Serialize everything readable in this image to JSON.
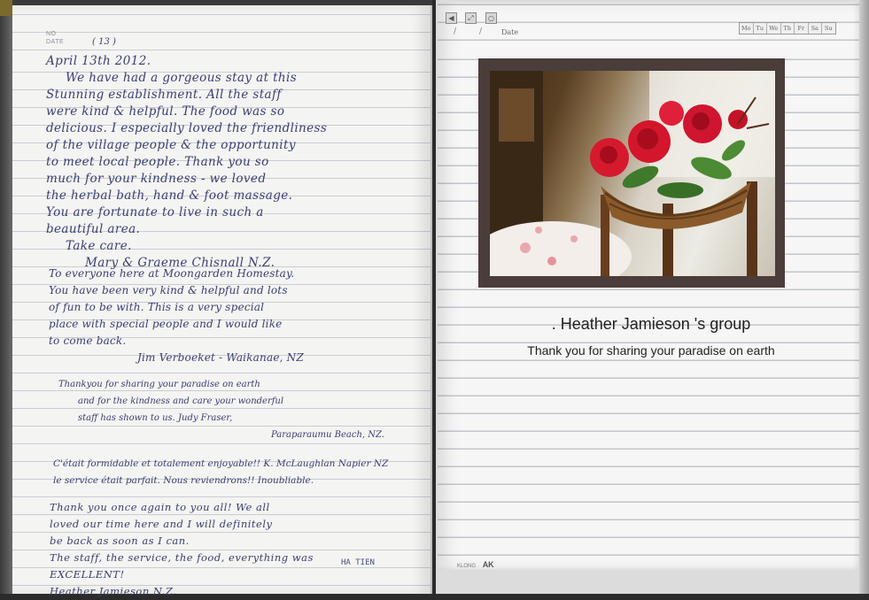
{
  "left_page": {
    "meta_no": "NO",
    "meta_date_label": "DATE",
    "meta_date_number": "( 13 )",
    "entry1": [
      "April 13th 2012.",
      "We have had a gorgeous stay at this",
      "Stunning establishment. All the staff",
      "were kind & helpful. The food was so",
      "delicious. I especially loved the friendliness",
      "of the village people & the opportunity",
      "to meet local people. Thank you so",
      "much for your kindness - we loved",
      "the herbal bath, hand & foot massage.",
      "You are fortunate to live in such a",
      "beautiful area.",
      "Take care.",
      "Mary & Graeme Chisnall N.Z."
    ],
    "entry2": [
      "To everyone here at Moongarden Homestay.",
      "You have been very kind & helpful and lots",
      "of fun to be with. This is a very special",
      "place with special people and I would like",
      "to come back.",
      "Jim Verboeket - Waikanae, NZ"
    ],
    "entry3": [
      "Thankyou for sharing your paradise on earth",
      "and for the kindness and care your wonderful",
      "staff has shown to us.   Judy Fraser,",
      "Paraparaumu Beach, NZ."
    ],
    "entry4": [
      "C'était formidable et totalement enjoyable!! K. McLaughlan Napier NZ",
      "le service était parfait. Nous reviendrons!! Inoubliable."
    ],
    "entry5": [
      "Thank you once again to you all! We all",
      "loved our time here and I will definitely",
      "be back as soon as I can.",
      "The staff, the service, the food, everything was",
      "EXCELLENT!",
      "Heather Jamieson N.Z."
    ],
    "stamp": "HA TIEN"
  },
  "right_page": {
    "date_label": "Date",
    "date_slash": "/",
    "weekdays": [
      "Mo",
      "Tu",
      "We",
      "Th",
      "Fr",
      "Sa",
      "Su"
    ],
    "caption_title": ". Heather Jamieson 's group",
    "caption_subtitle": "Thank you for sharing your paradise on earth",
    "footer_small": "KLONG",
    "footer_logo": "AK"
  },
  "colors": {
    "ink": "#3a3e72",
    "frame": "#4a3d3a",
    "caption": "#222222"
  }
}
